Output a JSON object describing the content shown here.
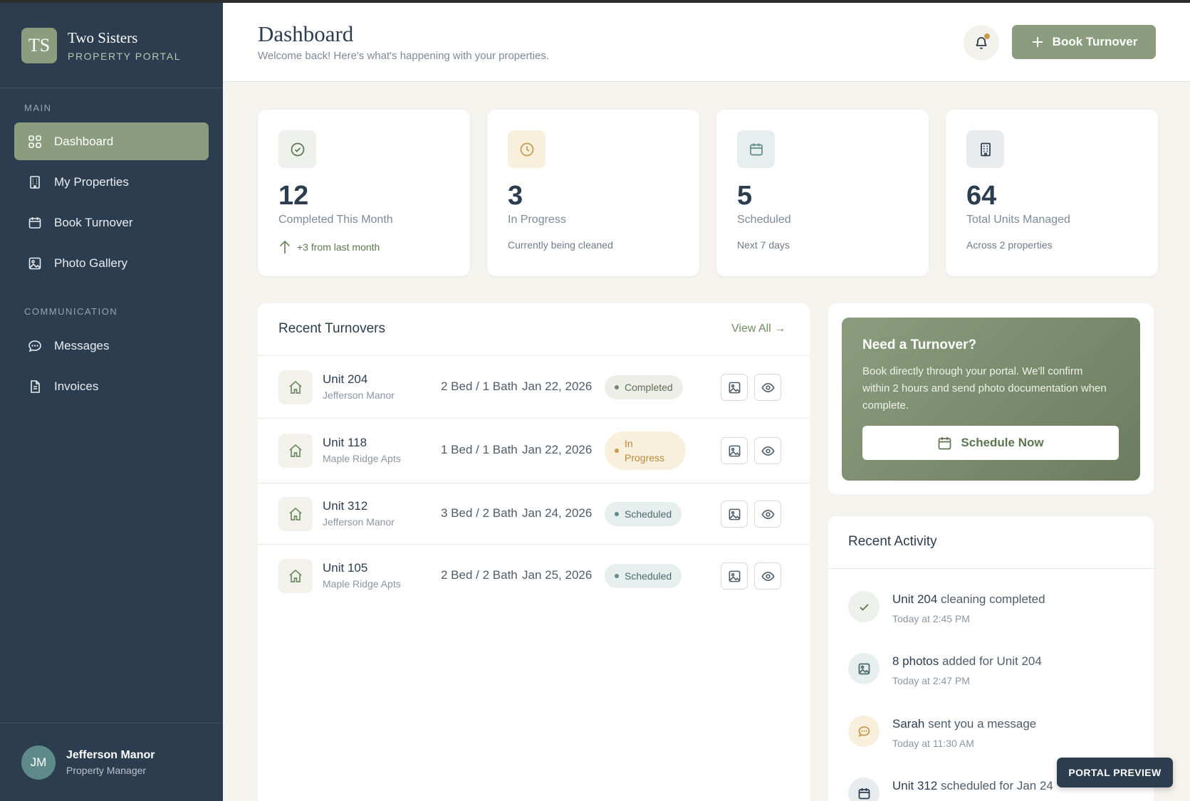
{
  "brand": {
    "initials": "TS",
    "name": "Two Sisters",
    "subtitle": "PROPERTY PORTAL"
  },
  "sidebar": {
    "sections": [
      {
        "label": "MAIN"
      },
      {
        "label": "COMMUNICATION"
      }
    ],
    "items": [
      {
        "label": "Dashboard",
        "icon": "grid-icon",
        "active": true
      },
      {
        "label": "My Properties",
        "icon": "building-icon"
      },
      {
        "label": "Book Turnover",
        "icon": "calendar-icon"
      },
      {
        "label": "Photo Gallery",
        "icon": "image-icon"
      },
      {
        "label": "Messages",
        "icon": "chat-icon"
      },
      {
        "label": "Invoices",
        "icon": "document-icon"
      }
    ]
  },
  "user": {
    "initials": "JM",
    "name": "Jefferson Manor",
    "role": "Property Manager"
  },
  "header": {
    "title": "Dashboard",
    "subtitle": "Welcome back! Here's what's happening with your properties.",
    "book_button": "Book Turnover"
  },
  "stats": [
    {
      "value": "12",
      "label": "Completed This Month",
      "foot": "+3 from last month",
      "icon": "check-circle-icon",
      "icon_bg": "#eef0eb",
      "icon_color": "#5c7551"
    },
    {
      "value": "3",
      "label": "In Progress",
      "foot": "Currently being cleaned",
      "icon": "clock-icon",
      "icon_bg": "#f8efdd",
      "icon_color": "#c89a4a"
    },
    {
      "value": "5",
      "label": "Scheduled",
      "foot": "Next 7 days",
      "icon": "calendar-icon",
      "icon_bg": "#e6eeee",
      "icon_color": "#5f8a8a"
    },
    {
      "value": "64",
      "label": "Total Units Managed",
      "foot": "Across 2 properties",
      "icon": "building-icon",
      "icon_bg": "#e9ecef",
      "icon_color": "#2d3d50"
    }
  ],
  "turnovers": {
    "title": "Recent Turnovers",
    "view_all": "View All →",
    "rows": [
      {
        "unit": "Unit 204",
        "property": "Jefferson Manor",
        "beds": "2 Bed / 1 Bath",
        "date": "Jan 22, 2026",
        "status": "Completed"
      },
      {
        "unit": "Unit 118",
        "property": "Maple Ridge Apts",
        "beds": "1 Bed / 1 Bath",
        "date": "Jan 22, 2026",
        "status_line1": "In",
        "status_line2": "Progress"
      },
      {
        "unit": "Unit 312",
        "property": "Jefferson Manor",
        "beds": "3 Bed / 2 Bath",
        "date": "Jan 24, 2026",
        "status": "Scheduled"
      },
      {
        "unit": "Unit 105",
        "property": "Maple Ridge Apts",
        "beds": "2 Bed / 2 Bath",
        "date": "Jan 25, 2026",
        "status": "Scheduled"
      }
    ]
  },
  "cta": {
    "title": "Need a Turnover?",
    "text": "Book directly through your portal. We'll confirm within 2 hours and send photo documentation when complete.",
    "button": "Schedule Now"
  },
  "activity": {
    "title": "Recent Activity",
    "items": [
      {
        "bold": "Unit 204",
        "rest": " cleaning completed",
        "time": "Today at 2:45 PM",
        "icon": "check-icon"
      },
      {
        "bold": "8 photos",
        "rest": " added for Unit 204",
        "time": "Today at 2:47 PM",
        "icon": "image-icon"
      },
      {
        "bold": "Sarah",
        "rest": " sent you a message",
        "time": "Today at 11:30 AM",
        "icon": "chat-icon"
      },
      {
        "bold": "Unit 312",
        "rest": " scheduled for Jan 24",
        "time": "",
        "icon": "calendar-icon"
      }
    ]
  },
  "preview_badge": "PORTAL PREVIEW"
}
